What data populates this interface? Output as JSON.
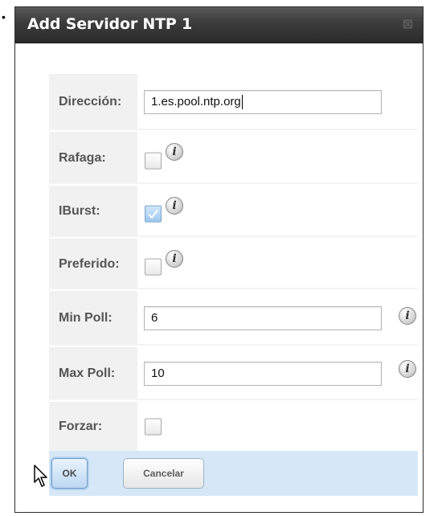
{
  "bullet": "•",
  "dialog": {
    "title": "Add Servidor NTP 1",
    "close_glyph": "⊠"
  },
  "form": {
    "direccion": {
      "label": "Dirección:",
      "value": "1.es.pool.ntp.org"
    },
    "rafaga": {
      "label": "Rafaga:",
      "checked": false
    },
    "iburst": {
      "label": "IBurst:",
      "checked": true
    },
    "preferido": {
      "label": "Preferido:",
      "checked": false
    },
    "min_poll": {
      "label": "Min Poll:",
      "value": "6"
    },
    "max_poll": {
      "label": "Max Poll:",
      "value": "10"
    },
    "forzar": {
      "label": "Forzar:",
      "checked": false
    }
  },
  "icons": {
    "info": "info-icon",
    "info_glyph": "i",
    "checkmark": "checkmark-icon",
    "cursor": "mouse-pointer-icon"
  },
  "buttons": {
    "ok": "OK",
    "cancel": "Cancelar"
  },
  "colors": {
    "titlebar": "#3a3a3a",
    "label_bg": "#f1f1f1",
    "footer_bg": "#d6e8f8",
    "checked_bg": "#9cc8ee"
  }
}
